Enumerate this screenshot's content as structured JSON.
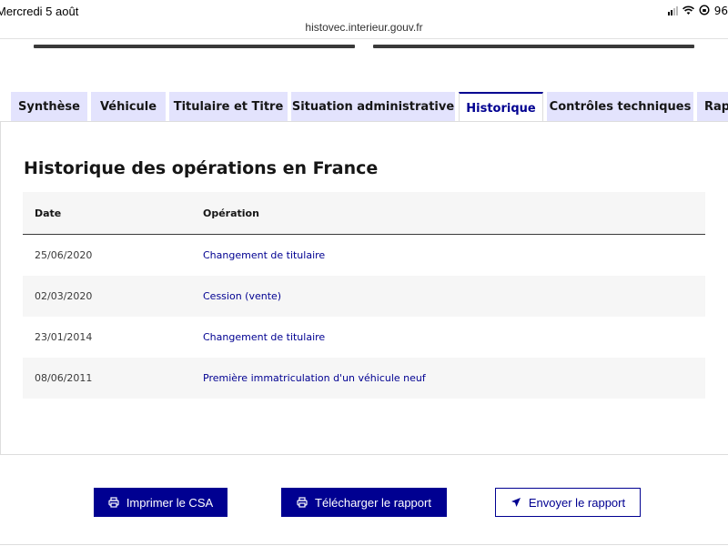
{
  "status": {
    "datetime": "Mercredi 5 août",
    "battery": "96"
  },
  "browser": {
    "url": "histovec.interieur.gouv.fr"
  },
  "tabs": [
    {
      "label": "Synthèse"
    },
    {
      "label": "Véhicule"
    },
    {
      "label": "Titulaire et Titre"
    },
    {
      "label": "Situation administrative"
    },
    {
      "label": "Historique"
    },
    {
      "label": "Contrôles techniques"
    },
    {
      "label": "Rapp"
    }
  ],
  "active_tab": "Historique",
  "history": {
    "title": "Historique des opérations en France",
    "columns": {
      "date": "Date",
      "operation": "Opération"
    },
    "rows": [
      {
        "date": "25/06/2020",
        "operation": "Changement de titulaire"
      },
      {
        "date": "02/03/2020",
        "operation": "Cession (vente)"
      },
      {
        "date": "23/01/2014",
        "operation": "Changement de titulaire"
      },
      {
        "date": "08/06/2011",
        "operation": "Première immatriculation d'un véhicule neuf"
      }
    ]
  },
  "actions": {
    "print_label": "Imprimer le CSA",
    "download_label": "Télécharger le rapport",
    "send_label": "Envoyer le rapport"
  },
  "icons": {
    "print": "printer-icon",
    "download": "printer-icon",
    "send": "send-arrow-icon",
    "signal": "cellular-signal-icon",
    "wifi": "wifi-icon",
    "lock": "rotation-lock-icon"
  },
  "colors": {
    "primary": "#000091",
    "tab_bg": "#e3e3fd",
    "row_alt": "#f6f6f6"
  }
}
